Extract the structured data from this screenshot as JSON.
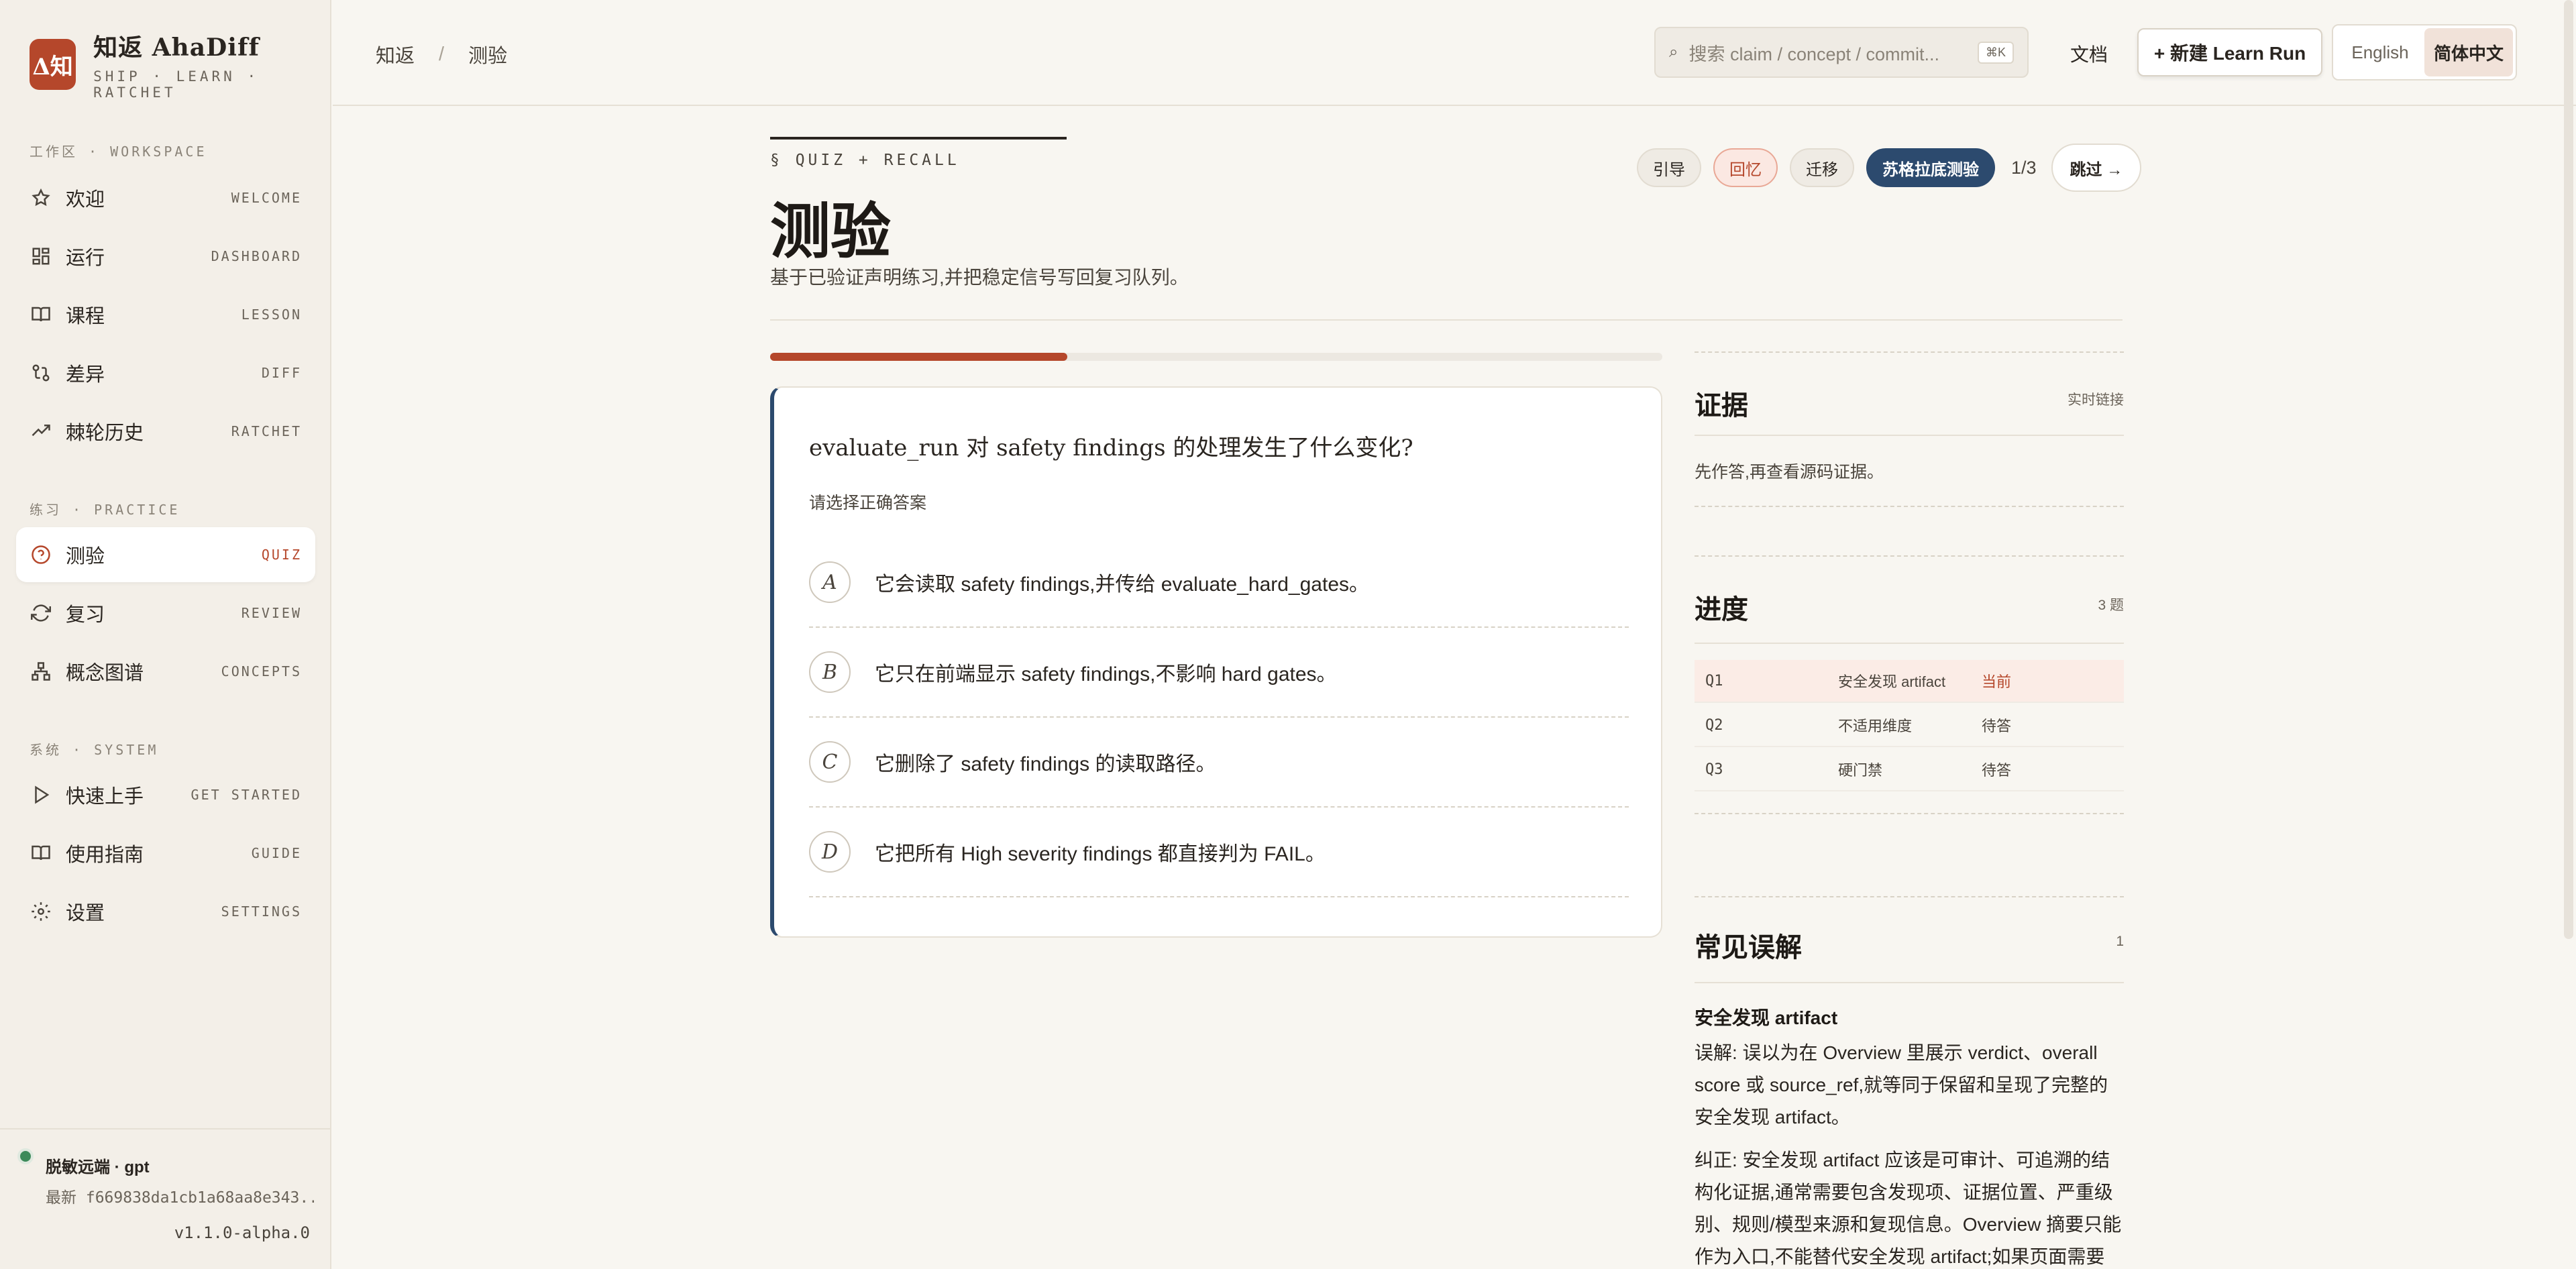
{
  "brand": {
    "logo_text": "Δ知",
    "name": "知返 AhaDiff",
    "tagline": "SHIP · LEARN · RATCHET"
  },
  "sidebar": {
    "groups": {
      "workspace": "工作区 · WORKSPACE",
      "practice": "练习 · PRACTICE",
      "system": "系统 · SYSTEM"
    },
    "items": [
      {
        "label": "欢迎",
        "code": "WELCOME",
        "icon": "star-icon"
      },
      {
        "label": "运行",
        "code": "DASHBOARD",
        "icon": "dashboard-icon"
      },
      {
        "label": "课程",
        "code": "LESSON",
        "icon": "book-icon"
      },
      {
        "label": "差异",
        "code": "DIFF",
        "icon": "diff-icon"
      },
      {
        "label": "棘轮历史",
        "code": "RATCHET",
        "icon": "trend-icon"
      },
      {
        "label": "测验",
        "code": "QUIZ",
        "icon": "help-circle-icon",
        "active": true
      },
      {
        "label": "复习",
        "code": "REVIEW",
        "icon": "refresh-icon"
      },
      {
        "label": "概念图谱",
        "code": "CONCEPTS",
        "icon": "graph-icon"
      },
      {
        "label": "快速上手",
        "code": "GET STARTED",
        "icon": "play-icon"
      },
      {
        "label": "使用指南",
        "code": "GUIDE",
        "icon": "guide-book-icon"
      },
      {
        "label": "设置",
        "code": "SETTINGS",
        "icon": "gear-icon"
      }
    ],
    "footer": {
      "remote_label": "脱敏远端 · gpt",
      "latest_commit": "最新 f669838da1cb1a68aa8e343...",
      "version": "v1.1.0-alpha.0"
    }
  },
  "topbar": {
    "breadcrumb": [
      "知返",
      "测验"
    ],
    "breadcrumb_sep": "/",
    "search": {
      "placeholder": "搜索 claim / concept / commit...",
      "shortcut": "⌘K"
    },
    "docs_label": "文档",
    "new_run_label": "+ 新建 Learn Run",
    "languages": [
      {
        "label": "English",
        "active": false
      },
      {
        "label": "简体中文",
        "active": true
      }
    ]
  },
  "header": {
    "kicker": "§ QUIZ + RECALL",
    "title": "测验",
    "subtitle": "基于已验证声明练习,并把稳定信号写回复习队列。"
  },
  "modes": {
    "items": [
      "引导",
      "回忆",
      "迁移",
      "苏格拉底测验"
    ],
    "active_index": 3,
    "counter": "1/3",
    "skip_label": "跳过 →"
  },
  "progress": {
    "fraction": 0.333
  },
  "question": {
    "text": "evaluate_run 对 safety findings 的处理发生了什么变化?",
    "hint": "请选择正确答案",
    "options": [
      {
        "letter": "A",
        "text": "它会读取 safety findings,并传给 evaluate_hard_gates。"
      },
      {
        "letter": "B",
        "text": "它只在前端显示 safety findings,不影响 hard gates。"
      },
      {
        "letter": "C",
        "text": "它删除了 safety findings 的读取路径。"
      },
      {
        "letter": "D",
        "text": "它把所有 High severity findings 都直接判为 FAIL。"
      }
    ]
  },
  "evidence": {
    "title": "证据",
    "meta": "实时链接",
    "text": "先作答,再查看源码证据。"
  },
  "progress_panel": {
    "title": "进度",
    "meta": "3 题",
    "rows": [
      {
        "id": "Q1",
        "name": "安全发现 artifact",
        "status": "当前",
        "current": true
      },
      {
        "id": "Q2",
        "name": "不适用维度",
        "status": "待答",
        "current": false
      },
      {
        "id": "Q3",
        "name": "硬门禁",
        "status": "待答",
        "current": false
      }
    ]
  },
  "misconceptions": {
    "title": "常见误解",
    "count": "1",
    "item_title": "安全发现 artifact",
    "wrong_lines": [
      "误解: 误以为在 Overview 里展示 verdict、overall",
      "score 或 source_ref,就等同于保留和呈现了完整的",
      "安全发现 artifact。"
    ],
    "fix_lines": [
      "纠正: 安全发现 artifact 应该是可审计、可追溯的结",
      "构化证据,通常需要包含发现项、证据位置、严重级",
      "别、规则/模型来源和复现信息。Overview 摘要只能",
      "作为入口,不能替代安全发现 artifact;如果页面需要"
    ]
  },
  "colors": {
    "accent": "#b5472b",
    "navy": "#2c4a6e",
    "background": "#f8f6f1",
    "sidebar": "#f3efe8",
    "status_dot": "#3d8a5a"
  }
}
